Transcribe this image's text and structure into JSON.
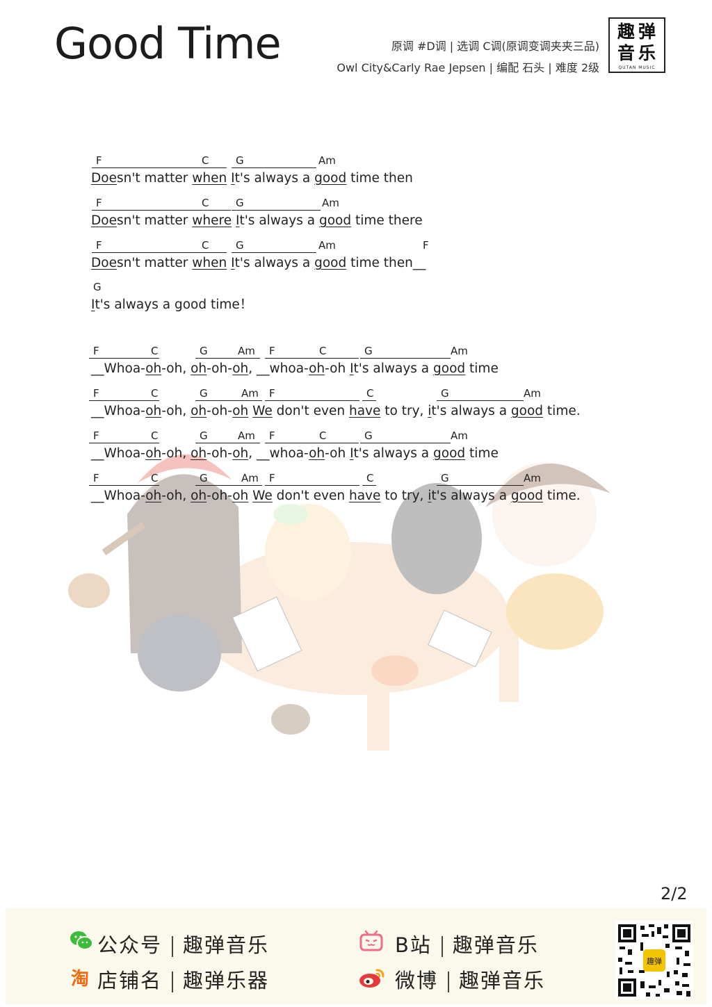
{
  "header": {
    "title": "Good Time",
    "meta_line1": "原调 #D调 | 选调 C调(原调变调夹夹三品)",
    "meta_line2": "Owl City&Carly Rae Jepsen | 编配  石头 | 难度 2级",
    "logo_chars": [
      "趣弹",
      "音乐"
    ],
    "logo_sub": "QUTAN MUSIC"
  },
  "page_number": "2/2",
  "lines": [
    {
      "chords": [
        "F",
        "C",
        "G",
        "Am"
      ],
      "lyric": [
        "",
        "Doe",
        "sn't matter ",
        "when",
        "  ",
        "I",
        "t's always a ",
        "good",
        " time then"
      ]
    },
    {
      "chords": [
        "F",
        "C",
        "G",
        "Am"
      ],
      "lyric": [
        "",
        "Doe",
        "sn't matter ",
        "where",
        "  ",
        "I",
        "t's always a ",
        "good",
        " time there"
      ]
    },
    {
      "chords": [
        "F",
        "C",
        "G",
        "Am",
        "F"
      ],
      "lyric": [
        "",
        "Doe",
        "sn't matter ",
        "when",
        "  ",
        "I",
        "t's always a ",
        "good",
        " time then__"
      ]
    },
    {
      "chords": [
        "G"
      ],
      "lyric": [
        "",
        "I",
        "t's always a good time！"
      ]
    },
    {
      "chords": [
        "F",
        "C",
        "G",
        "Am",
        "F",
        "C",
        "G",
        "Am"
      ],
      "lyric": [
        "__Whoa-",
        "oh",
        "-oh, ",
        "oh",
        "-oh-",
        "oh",
        ",  __whoa-",
        "oh",
        "-oh  ",
        "I",
        "t's always a ",
        "good",
        " time"
      ]
    },
    {
      "chords": [
        "F",
        "C",
        "G",
        "Am",
        "F",
        "C",
        "G",
        "Am"
      ],
      "lyric": [
        "__Whoa-",
        "oh",
        "-oh, ",
        "oh",
        "-oh-",
        "oh",
        "  ",
        "We",
        " don't even ",
        "have",
        " to try, ",
        "i",
        "t's always a ",
        "good",
        " time."
      ]
    },
    {
      "chords": [
        "F",
        "C",
        "G",
        "Am",
        "F",
        "C",
        "G",
        "Am"
      ],
      "lyric": [
        "__Whoa-",
        "oh",
        "-oh, ",
        "oh",
        "-oh-",
        "oh",
        ",  __whoa-",
        "oh",
        "-oh  ",
        "I",
        "t's always a ",
        "good",
        " time"
      ]
    },
    {
      "chords": [
        "F",
        "C",
        "G",
        "Am",
        "F",
        "C",
        "G",
        "Am"
      ],
      "lyric": [
        "__Whoa-",
        "oh",
        "-oh, ",
        "oh",
        "-oh-",
        "oh",
        "  ",
        "We",
        " don't even ",
        "have",
        " to try, ",
        "i",
        "t's always a ",
        "good",
        " time."
      ]
    }
  ],
  "footer": {
    "wechat": {
      "label": "公众号",
      "value": "趣弹音乐"
    },
    "taobao": {
      "label": "店铺名",
      "value": "趣弹乐器"
    },
    "bilibili": {
      "label": "B站",
      "value": "趣弹音乐"
    },
    "weibo": {
      "label": "微博",
      "value": "趣弹音乐"
    },
    "qr_badge": "趣弹"
  },
  "colors": {
    "wechat": "#3dbb3a",
    "taobao": "#f06a10",
    "bilibili": "#f06b86",
    "weibo": "#e6393d",
    "footer_bg": "#fbf8ec"
  }
}
